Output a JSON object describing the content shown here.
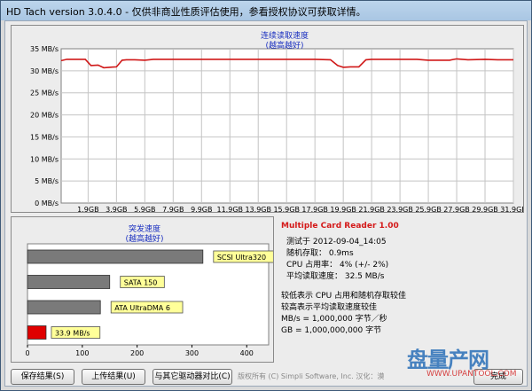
{
  "window": {
    "title": "HD Tach version 3.0.4.0  - 仅供非商业性质评估使用，参看授权协议可获取详情。"
  },
  "sequential": {
    "title": "连续读取速度",
    "subtitle": "(越高越好)"
  },
  "burst": {
    "title": "突发速度",
    "subtitle": "(越高越好)"
  },
  "info": {
    "heading": "Multiple Card Reader 1.00",
    "lines": [
      "测试于 2012-09-04_14:05",
      "随机存取： 0.9ms",
      "CPU 占用率： 4% (+/- 2%)",
      "平均读取速度： 32.5 MB/s"
    ],
    "notes": [
      "较低表示 CPU 占用和随机存取较佳",
      "较高表示平均读取速度较佳",
      "MB/s = 1,000,000 字节／秒",
      "GB = 1,000,000,000 字节"
    ]
  },
  "buttons": {
    "save": "保存结果(S)",
    "upload": "上传结果(U)",
    "compare": "与其它驱动器对比(C)",
    "done": "完成"
  },
  "copyright": "版权所有 (C) Simpli Software, Inc. 汉化：漠",
  "watermark": {
    "brand": "盘量产网",
    "url": "WWW.UPANTOOL.COM"
  },
  "chart_data": [
    {
      "type": "line",
      "title": "连续读取速度",
      "subtitle": "(越高越好)",
      "y_unit_labels": [
        "0 MB/s",
        "5 MB/s",
        "10 MB/s",
        "15 MB/s",
        "20 MB/s",
        "25 MB/s",
        "30 MB/s",
        "35 MB/s"
      ],
      "ylim": [
        0,
        35
      ],
      "x_tick_labels": [
        "1.9GB",
        "3.9GB",
        "5.9GB",
        "7.9GB",
        "9.9GB",
        "11.9GB",
        "13.9GB",
        "15.9GB",
        "17.9GB",
        "19.9GB",
        "21.9GB",
        "23.9GB",
        "25.9GB",
        "27.9GB",
        "29.9GB",
        "31.9GB"
      ],
      "x_ticks_gb": [
        1.9,
        3.9,
        5.9,
        7.9,
        9.9,
        11.9,
        13.9,
        15.9,
        17.9,
        19.9,
        21.9,
        23.9,
        25.9,
        27.9,
        29.9,
        31.9
      ],
      "xlim": [
        0,
        31.9
      ],
      "grid": true,
      "line_color": "#d01818",
      "series": [
        {
          "x": [
            0,
            0.4,
            0.9,
            1.7,
            2.1,
            2.6,
            3.0,
            3.4,
            3.9,
            4.3,
            4.6,
            5.2,
            5.9,
            6.5,
            7.9,
            9.9,
            11.9,
            13.9,
            15.9,
            17.9,
            19.0,
            19.5,
            19.9,
            20.4,
            21.0,
            21.5,
            21.9,
            23.0,
            24.0,
            25.1,
            25.9,
            26.5,
            27.4,
            27.9,
            28.7,
            29.9,
            30.8,
            31.9
          ],
          "y": [
            32.3,
            32.6,
            32.6,
            32.6,
            31.2,
            31.3,
            30.7,
            30.8,
            30.9,
            32.4,
            32.5,
            32.5,
            32.4,
            32.6,
            32.6,
            32.6,
            32.6,
            32.6,
            32.6,
            32.6,
            32.5,
            31.2,
            30.8,
            30.9,
            30.9,
            32.5,
            32.6,
            32.6,
            32.6,
            32.6,
            32.4,
            32.4,
            32.4,
            32.7,
            32.5,
            32.6,
            32.5,
            32.5
          ]
        }
      ]
    },
    {
      "type": "bar",
      "orientation": "horizontal",
      "title": "突发速度",
      "subtitle": "(越高越好)",
      "categories": [
        "SCSI Ultra320",
        "SATA 150",
        "ATA UltraDMA 6",
        "33.9 MB/s"
      ],
      "values": [
        320,
        150,
        133,
        33.9
      ],
      "colors": [
        "#7a7a7a",
        "#7a7a7a",
        "#7a7a7a",
        "#e00000"
      ],
      "x_tick_labels": [
        "0",
        "100",
        "200",
        "300",
        "400"
      ],
      "xlim": [
        0,
        440
      ],
      "grid": false
    }
  ]
}
